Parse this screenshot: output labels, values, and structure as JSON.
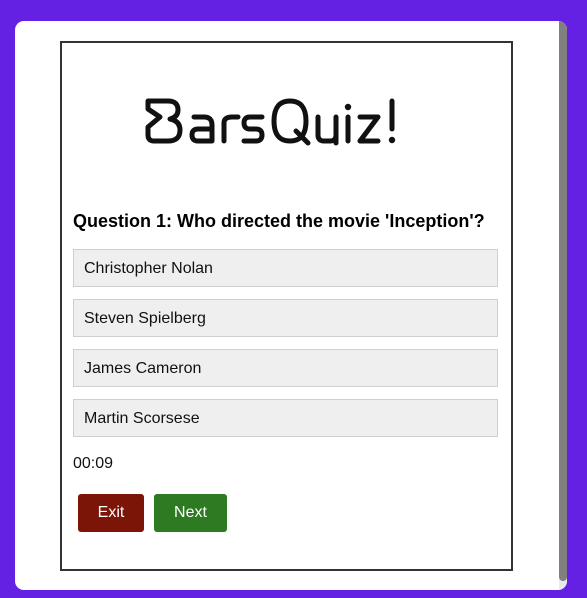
{
  "app": {
    "logo_text": "BarsQuiz!"
  },
  "quiz": {
    "question": "Question 1: Who directed the movie 'Inception'?",
    "options": [
      "Christopher Nolan",
      "Steven Spielberg",
      "James Cameron",
      "Martin Scorsese"
    ],
    "timer": "00:09"
  },
  "buttons": {
    "exit_label": "Exit",
    "next_label": "Next"
  },
  "colors": {
    "page_background": "#6420e3",
    "exit_button": "#7a1508",
    "next_button": "#2e7a22",
    "option_background": "#efefef"
  }
}
